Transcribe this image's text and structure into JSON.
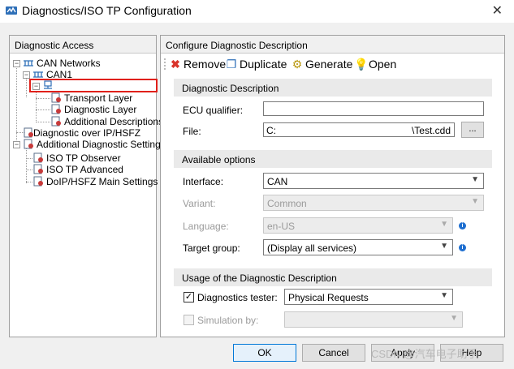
{
  "window": {
    "title": "Diagnostics/ISO TP Configuration",
    "close_glyph": "✕"
  },
  "left_panel": {
    "header": "Diagnostic Access",
    "tree": [
      {
        "label": "CAN Networks",
        "icon": "network-icon",
        "expander": "−"
      },
      {
        "label": "CAN1",
        "icon": "network-icon",
        "expander": "−"
      },
      {
        "label": "",
        "icon": "ecu-node-icon",
        "expander": "−"
      },
      {
        "label": "Transport Layer",
        "icon": "settings-page-icon"
      },
      {
        "label": "Diagnostic Layer",
        "icon": "settings-page-icon"
      },
      {
        "label": "Additional Descriptions",
        "icon": "settings-page-icon"
      },
      {
        "label": "Diagnostic over IP/HSFZ",
        "icon": "settings-page-icon"
      },
      {
        "label": "Additional Diagnostic Settings",
        "icon": "settings-page-icon",
        "expander": "−"
      },
      {
        "label": "ISO TP Observer",
        "icon": "settings-page-icon"
      },
      {
        "label": "ISO TP Advanced",
        "icon": "settings-page-icon"
      },
      {
        "label": "DoIP/HSFZ Main Settings",
        "icon": "settings-page-icon"
      }
    ]
  },
  "right_panel": {
    "header": "Configure Diagnostic Description",
    "toolbar": {
      "remove": "Remove",
      "duplicate": "Duplicate",
      "generate": "Generate",
      "open": "Open"
    },
    "sections": {
      "description": "Diagnostic Description",
      "options": "Available options",
      "usage": "Usage of the Diagnostic Description"
    },
    "fields": {
      "ecu_qualifier_label": "ECU qualifier:",
      "ecu_qualifier_value": "",
      "file_label": "File:",
      "file_value_start": "C:",
      "file_value_end": "\\Test.cdd",
      "browse_label": "...",
      "interface_label": "Interface:",
      "interface_value": "CAN",
      "variant_label": "Variant:",
      "variant_value": "Common",
      "language_label": "Language:",
      "language_value": "en-US",
      "target_group_label": "Target group:",
      "target_group_value": "(Display all services)",
      "diag_tester_label": "Diagnostics tester:",
      "diag_tester_checked": true,
      "diag_tester_value": "Physical Requests",
      "simulation_label": "Simulation by:",
      "simulation_checked": false,
      "simulation_value": ""
    }
  },
  "buttons": {
    "ok": "OK",
    "cancel": "Cancel",
    "apply": "Apply",
    "help": "Help"
  },
  "watermark": "CSDN @汽车电子助手",
  "colors": {
    "highlight_box": "#e0201a",
    "info_icon": "#1f6fd0",
    "default_button_border": "#0078d7"
  }
}
